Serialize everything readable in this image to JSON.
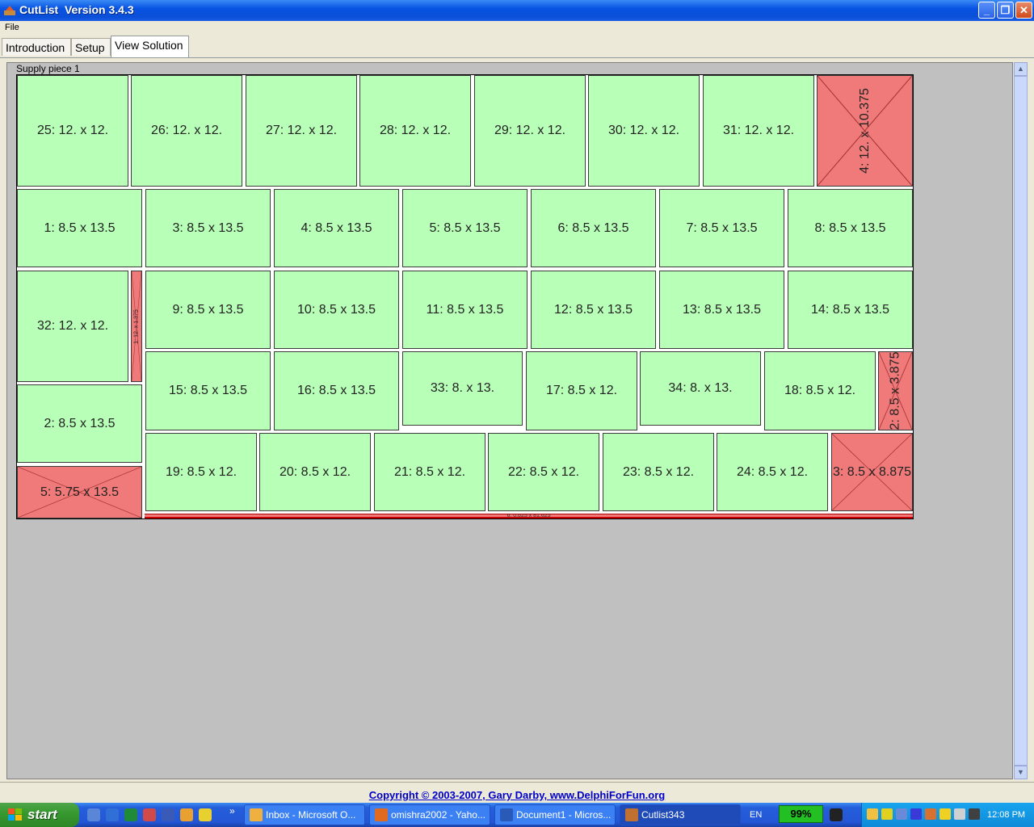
{
  "window": {
    "title": "CutList  Version 3.4.3",
    "menu": [
      "File"
    ]
  },
  "tabs": [
    {
      "label": "Introduction",
      "active": false
    },
    {
      "label": "Setup",
      "active": false
    },
    {
      "label": "View Solution",
      "active": true
    }
  ],
  "solution": {
    "sheet_label": "Supply piece 1",
    "pieces": [
      {
        "label": "25: 12. x 12."
      },
      {
        "label": "26: 12. x 12."
      },
      {
        "label": "27: 12. x 12."
      },
      {
        "label": "28: 12. x 12."
      },
      {
        "label": "29: 12. x 12."
      },
      {
        "label": "30: 12. x 12."
      },
      {
        "label": "31: 12. x 12."
      },
      {
        "label": "1: 8.5 x 13.5"
      },
      {
        "label": "3: 8.5 x 13.5"
      },
      {
        "label": "4: 8.5 x 13.5"
      },
      {
        "label": "5: 8.5 x 13.5"
      },
      {
        "label": "6: 8.5 x 13.5"
      },
      {
        "label": "7: 8.5 x 13.5"
      },
      {
        "label": "8: 8.5 x 13.5"
      },
      {
        "label": "32: 12. x 12."
      },
      {
        "label": "9: 8.5 x 13.5"
      },
      {
        "label": "10: 8.5 x 13.5"
      },
      {
        "label": "11: 8.5 x 13.5"
      },
      {
        "label": "12: 8.5 x 13.5"
      },
      {
        "label": "13: 8.5 x 13.5"
      },
      {
        "label": "14: 8.5 x 13.5"
      },
      {
        "label": "15: 8.5 x 13.5"
      },
      {
        "label": "16: 8.5 x 13.5"
      },
      {
        "label": "33: 8. x 13."
      },
      {
        "label": "17: 8.5 x 12."
      },
      {
        "label": "34: 8. x 13."
      },
      {
        "label": "18: 8.5 x 12."
      },
      {
        "label": "2: 8.5 x 13.5"
      },
      {
        "label": "19: 8.5 x 12."
      },
      {
        "label": "20: 8.5 x 12."
      },
      {
        "label": "21: 8.5 x 12."
      },
      {
        "label": "22: 8.5 x 12."
      },
      {
        "label": "23: 8.5 x 12."
      },
      {
        "label": "24: 8.5 x 12."
      }
    ],
    "waste": [
      {
        "label": "4: 12. x 10.375"
      },
      {
        "label": "1: 12. x 1.375"
      },
      {
        "label": "2: 8.5 x 3.875"
      },
      {
        "label": "3: 8.5 x 8.875"
      },
      {
        "label": "5: 5.75 x 13.5"
      },
      {
        "label": "6: 0.625 x 81.625"
      }
    ]
  },
  "footer": {
    "copyright": "Copyright  © 2003-2007, Gary Darby,  www.DelphiForFun.org"
  },
  "taskbar": {
    "start_label": "start",
    "tasks": [
      {
        "label": "Inbox - Microsoft O..."
      },
      {
        "label": "omishra2002 - Yaho..."
      },
      {
        "label": "Document1 - Micros..."
      },
      {
        "label": "Cutlist343"
      }
    ],
    "language": "EN",
    "battery": "99%",
    "clock": "12:08 PM"
  },
  "colors": {
    "piece_fill": "#b8ffb8",
    "waste_fill": "#f07a7a",
    "canvas_bg": "#c0c0c0",
    "link_blue": "#0000cc"
  }
}
